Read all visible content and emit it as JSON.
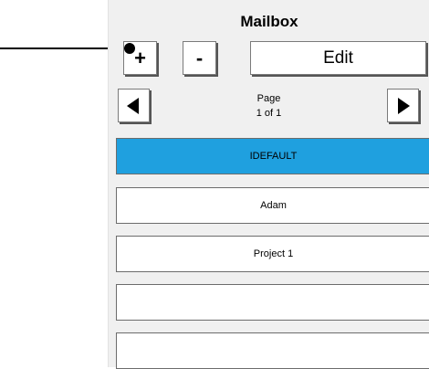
{
  "title": "Mailbox",
  "toolbar": {
    "add_label": "+",
    "remove_label": "-",
    "edit_label": "Edit"
  },
  "pagination": {
    "label": "Page",
    "value": "1 of 1",
    "prev_icon": "triangle-left-icon",
    "next_icon": "triangle-right-icon"
  },
  "mailboxes": [
    {
      "label": "IDEFAULT",
      "selected": true
    },
    {
      "label": "Adam",
      "selected": false
    },
    {
      "label": "Project 1",
      "selected": false
    },
    {
      "label": "",
      "selected": false
    },
    {
      "label": "",
      "selected": false
    }
  ],
  "colors": {
    "selected": "#1fa0df",
    "panel": "#f0f0f0"
  }
}
